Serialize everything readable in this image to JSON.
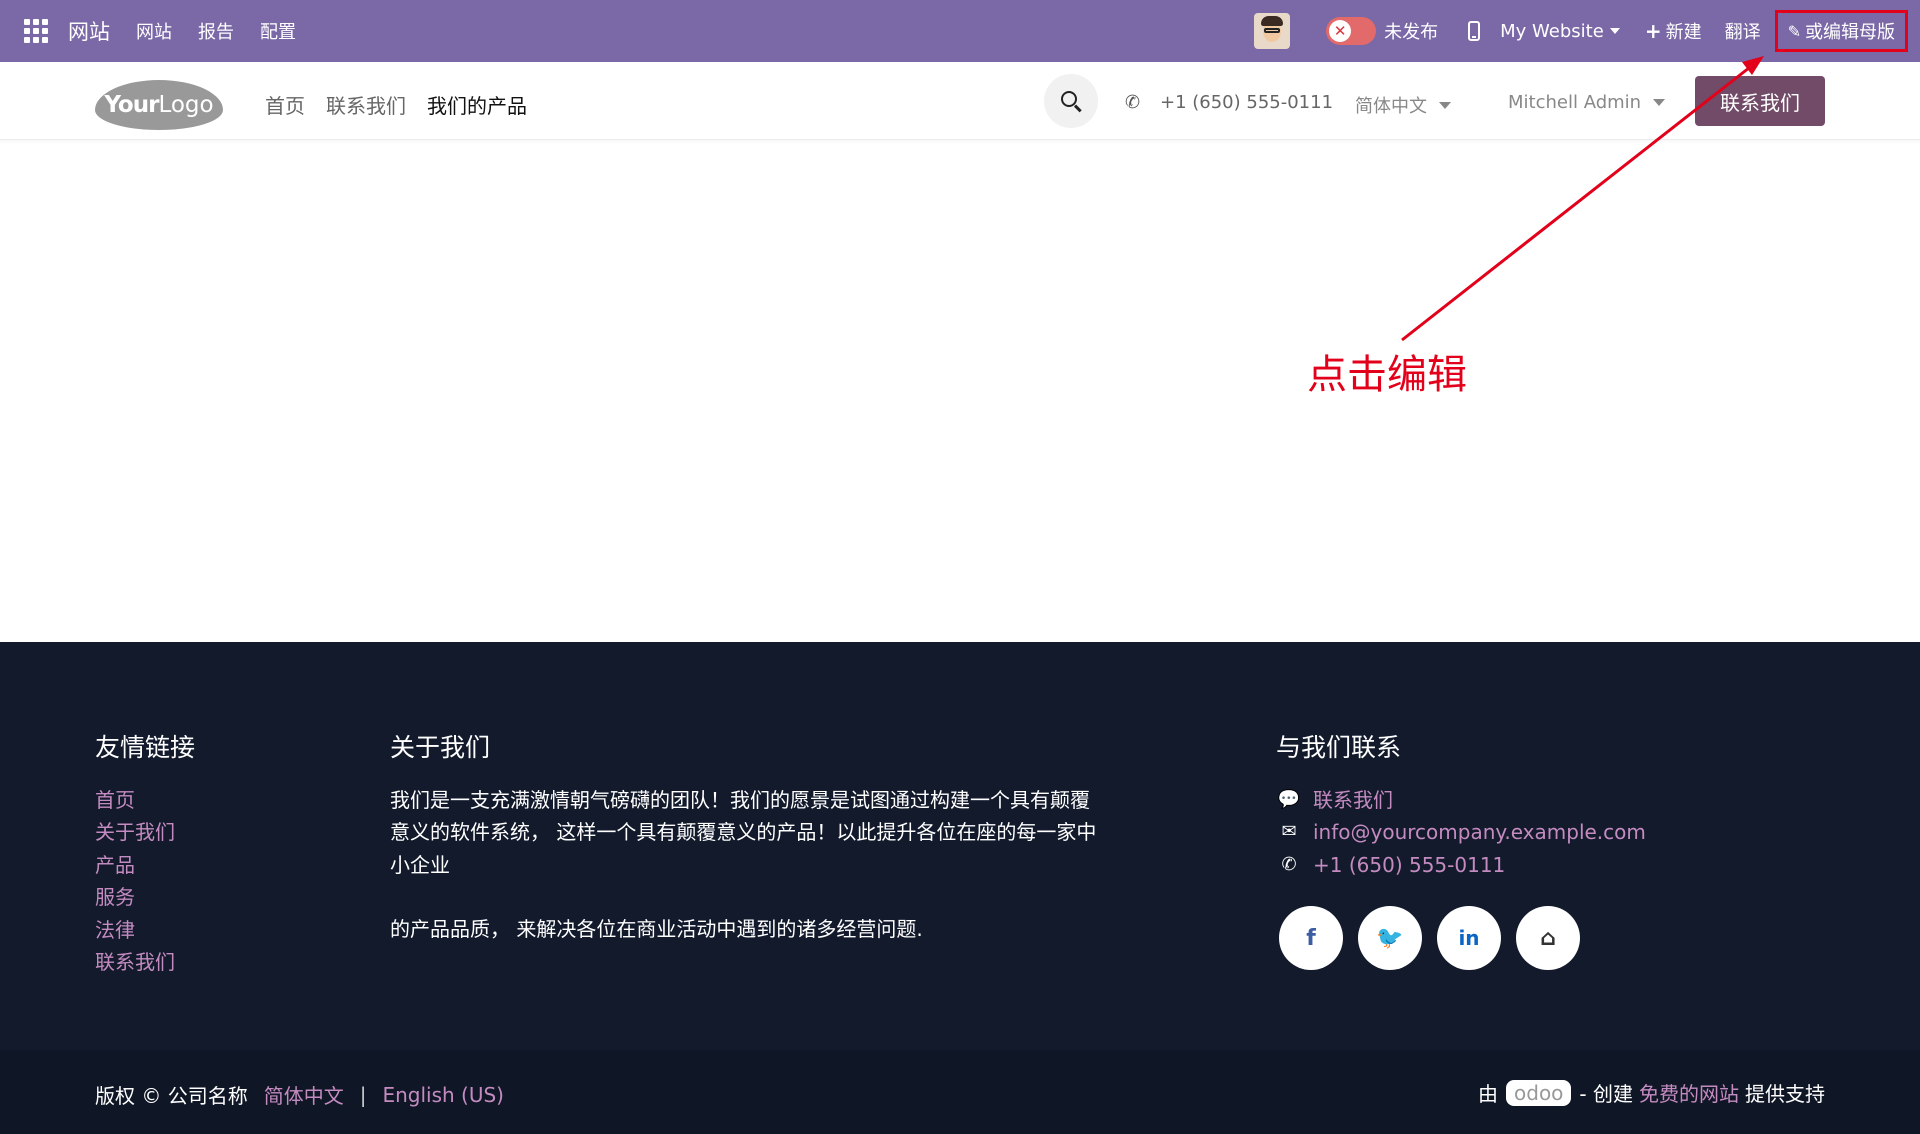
{
  "adminbar": {
    "brand": "网站",
    "menu": [
      "网站",
      "报告",
      "配置"
    ],
    "publish_status": "未发布",
    "website": "My Website",
    "new_label": "新建",
    "translate_label": "翻译",
    "edit_label": "或编辑母版"
  },
  "header": {
    "logo_bold": "Your",
    "logo_light": "Logo",
    "nav": [
      "首页",
      "联系我们",
      "我们的产品"
    ],
    "phone": "+1 (650) 555-0111",
    "language": "简体中文",
    "user": "Mitchell Admin",
    "cta": "联系我们"
  },
  "annotation": {
    "text": "点击编辑",
    "color": "#e2001a"
  },
  "footer": {
    "links_title": "友情链接",
    "links": [
      "首页",
      "关于我们",
      "产品",
      "服务",
      "法律",
      "联系我们"
    ],
    "about_title": "关于我们",
    "about_p1": "我们是一支充满激情朝气磅礴的团队！我们的愿景是试图通过构建一个具有颠覆意义的软件系统， 这样一个具有颠覆意义的产品！以此提升各位在座的每一家中小企业",
    "about_p2": "的产品品质， 来解决各位在商业活动中遇到的诸多经营问题.",
    "contact_title": "与我们联系",
    "contact_link": "联系我们",
    "email": "info@yourcompany.example.com",
    "phone": "+1 (650) 555-0111",
    "social": [
      {
        "icon": "facebook-icon",
        "glyph": "f"
      },
      {
        "icon": "twitter-icon",
        "glyph": "🐦"
      },
      {
        "icon": "linkedin-icon",
        "glyph": "in"
      },
      {
        "icon": "home-icon",
        "glyph": "⌂"
      }
    ]
  },
  "copyright": {
    "text": "版权 © 公司名称",
    "lang_1": "简体中文",
    "separator": "|",
    "lang_2": "English (US)",
    "by": "由",
    "odoo": "odoo",
    "create": "- 创建",
    "free_site": "免费的网站",
    "support": "提供支持"
  },
  "colors": {
    "adminbar": "#7b68a6",
    "primary": "#714b67",
    "footer_bg": "#121a2c",
    "link": "#c48bc0"
  }
}
